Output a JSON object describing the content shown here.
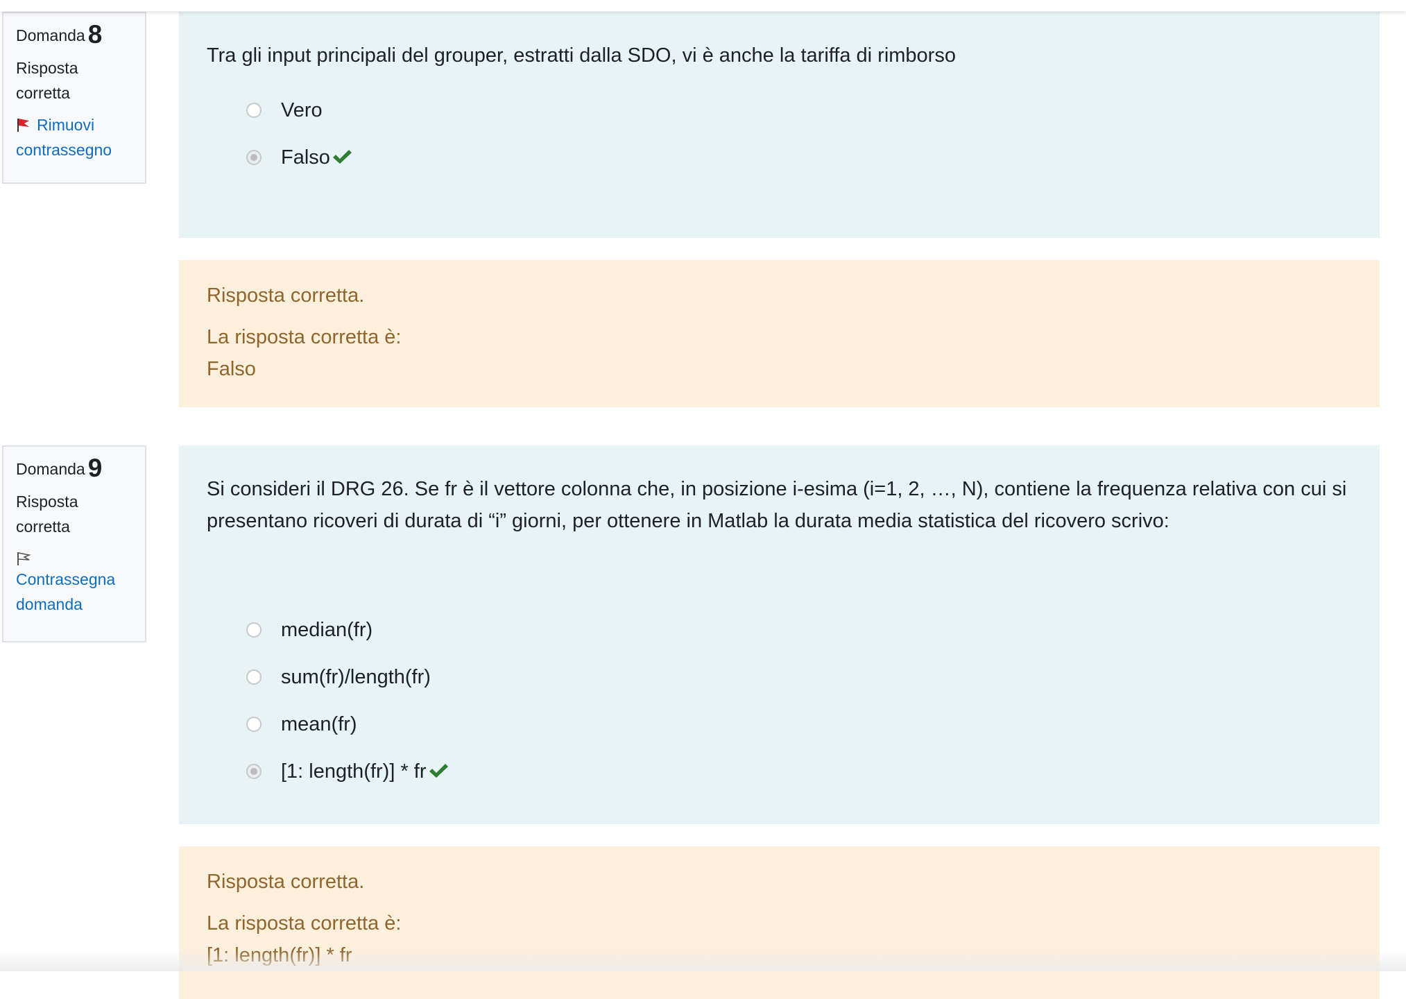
{
  "questions": [
    {
      "label": "Domanda",
      "number": "8",
      "state": "Risposta corretta",
      "flag_label": "Rimuovi contrassegno",
      "flag_icon": "red-flag-icon",
      "text": "Tra gli input principali del grouper, estratti dalla SDO, vi è anche la tariffa di rimborso",
      "options": [
        {
          "label": "Vero",
          "selected": false,
          "correct": false
        },
        {
          "label": "Falso",
          "selected": true,
          "correct": true
        }
      ],
      "feedback": {
        "state": "Risposta corretta.",
        "right_answer_label": "La risposta corretta è:",
        "right_answer": "Falso"
      }
    },
    {
      "label": "Domanda",
      "number": "9",
      "state": "Risposta corretta",
      "flag_label": "Contrassegna domanda",
      "flag_icon": "outline-flag-icon",
      "text": "Si consideri il DRG 26. Se fr è il vettore colonna che, in posizione i-esima (i=1, 2, …, N), contiene la frequenza relativa con cui si presentano ricoveri di durata di “i” giorni, per ottenere in Matlab la durata media statistica del ricovero scrivo:",
      "options": [
        {
          "label": "median(fr)",
          "selected": false,
          "correct": false
        },
        {
          "label": "sum(fr)/length(fr)",
          "selected": false,
          "correct": false
        },
        {
          "label": "mean(fr)",
          "selected": false,
          "correct": false
        },
        {
          "label": "[1: length(fr)] * fr",
          "selected": true,
          "correct": true
        }
      ],
      "feedback": {
        "state": "Risposta corretta.",
        "right_answer_label": "La risposta corretta è:",
        "right_answer": "[1: length(fr)] * fr"
      }
    }
  ],
  "colors": {
    "formulation_bg": "#e7f3f5",
    "feedback_bg": "#fcefdc",
    "feedback_text": "#8e662e",
    "link": "#0f6cbf",
    "check": "#2f7d32",
    "flag_red": "#d9232d"
  }
}
